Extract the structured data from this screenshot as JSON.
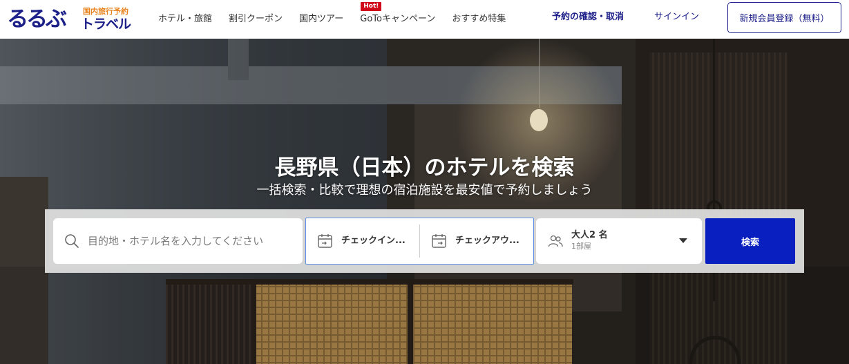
{
  "header": {
    "logo": {
      "main": "るるぶ",
      "sub": "国内旅行予約",
      "travel": "トラベル"
    },
    "nav": [
      {
        "label": "ホテル・旅館"
      },
      {
        "label": "割引クーポン"
      },
      {
        "label": "国内ツアー"
      },
      {
        "label": "GoToキャンペーン",
        "badge": "Hot!"
      },
      {
        "label": "おすすめ特集"
      }
    ],
    "confirm_label": "予約の確認・取消",
    "signin_label": "サインイン",
    "register_label": "新規会員登録（無料）"
  },
  "hero": {
    "title": "長野県（日本）のホテルを検索",
    "subtitle": "一括検索・比較で理想の宿泊施設を最安値で予約しましょう"
  },
  "search": {
    "destination_placeholder": "目的地・ホテル名を入力してください",
    "destination_value": "",
    "checkin_label": "チェックイン...",
    "checkout_label": "チェックアウ...",
    "guests_label": "大人2 名",
    "rooms_label": "1部屋",
    "search_button": "検索"
  },
  "colors": {
    "brand": "#1d2088",
    "accent_orange": "#e8821c",
    "hot_badge": "#d10a1b",
    "search_button": "#0a1fc0",
    "date_border": "#5b8de4"
  },
  "icons": [
    "search-icon",
    "calendar-checkin-icon",
    "calendar-checkout-icon",
    "people-icon",
    "caret-down-icon"
  ]
}
